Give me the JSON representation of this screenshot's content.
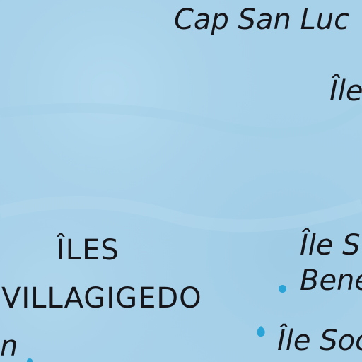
{
  "map": {
    "colors": {
      "ocean": "#a7d1e9",
      "ocean_light": "#b3d8ee",
      "ocean_dark": "#9ccae4",
      "island": "#2aa3d6",
      "label_text": "#15151a"
    },
    "labels": {
      "cap_san_lucas": "Cap San Luc",
      "ile_top_right": "Île",
      "iles_line1": "ÎLES",
      "iles_line2": "VILLAGIGEDO",
      "ile_san_benedicto_line1": "Île S",
      "ile_san_benedicto_line2": "Bene",
      "ile_socorro": "Île Soc",
      "partial_left": "n"
    }
  }
}
